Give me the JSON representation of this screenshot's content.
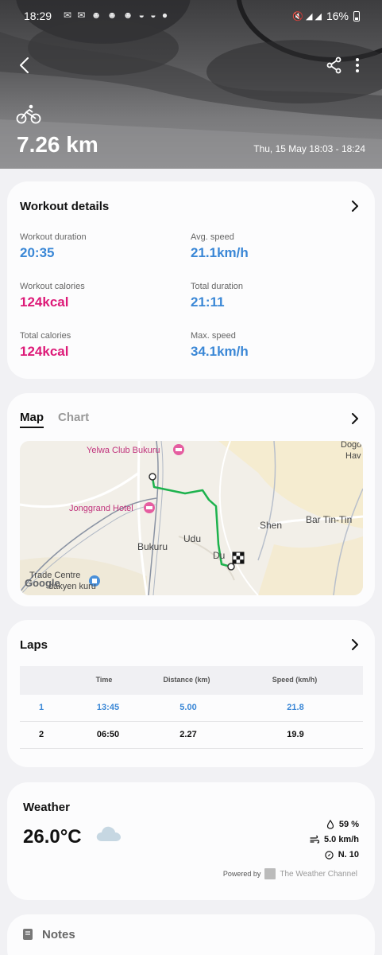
{
  "status_bar": {
    "time": "18:29",
    "notification_icons": "✉ ✉ ☻ ☻ ☻ ◒ ◒ ●",
    "right_icons": "🔇 ◢ ◢",
    "battery": "16%"
  },
  "header": {
    "distance": "7.26 km",
    "date_range": "Thu, 15 May 18:03 - 18:24",
    "activity_icon": "bike-icon"
  },
  "workout_details": {
    "title": "Workout details",
    "stats": [
      {
        "label": "Workout duration",
        "value": "20:35",
        "color": "#3a87d6"
      },
      {
        "label": "Avg. speed",
        "value": "21.1km/h",
        "color": "#3a87d6"
      },
      {
        "label": "Workout calories",
        "value": "124kcal",
        "color": "#dd1a78"
      },
      {
        "label": "Total duration",
        "value": "21:11",
        "color": "#3a87d6"
      },
      {
        "label": "Total calories",
        "value": "124kcal",
        "color": "#dd1a78"
      },
      {
        "label": "Max. speed",
        "value": "34.1km/h",
        "color": "#3a87d6"
      }
    ]
  },
  "map_section": {
    "tab_active": "Map",
    "tab_inactive": "Chart",
    "labels": {
      "yelwa": "Yelwa Club Bukuru",
      "jonggrand": "Jonggrand Hotel",
      "dogo": "Dogo",
      "hav": "Hav",
      "shen": "Shen",
      "bartintin": "Bar Tin-Tin",
      "bukuru": "Bukuru",
      "udu": "Udu",
      "du": "Du",
      "trade": "Trade Centre",
      "dakyen": "dakyen kuru",
      "google": "Google"
    }
  },
  "laps": {
    "title": "Laps",
    "headers": [
      "Time",
      "Distance (km)",
      "Speed (km/h)"
    ],
    "rows": [
      {
        "lap": "1",
        "time": "13:45",
        "distance": "5.00",
        "speed": "21.8"
      },
      {
        "lap": "2",
        "time": "06:50",
        "distance": "2.27",
        "speed": "19.9"
      }
    ]
  },
  "weather": {
    "title": "Weather",
    "temperature": "26.0°C",
    "humidity": "59 %",
    "wind": "5.0 km/h",
    "direction": "N. 10",
    "powered_by": "Powered by",
    "provider": "The Weather Channel"
  },
  "notes": {
    "title": "Notes"
  }
}
